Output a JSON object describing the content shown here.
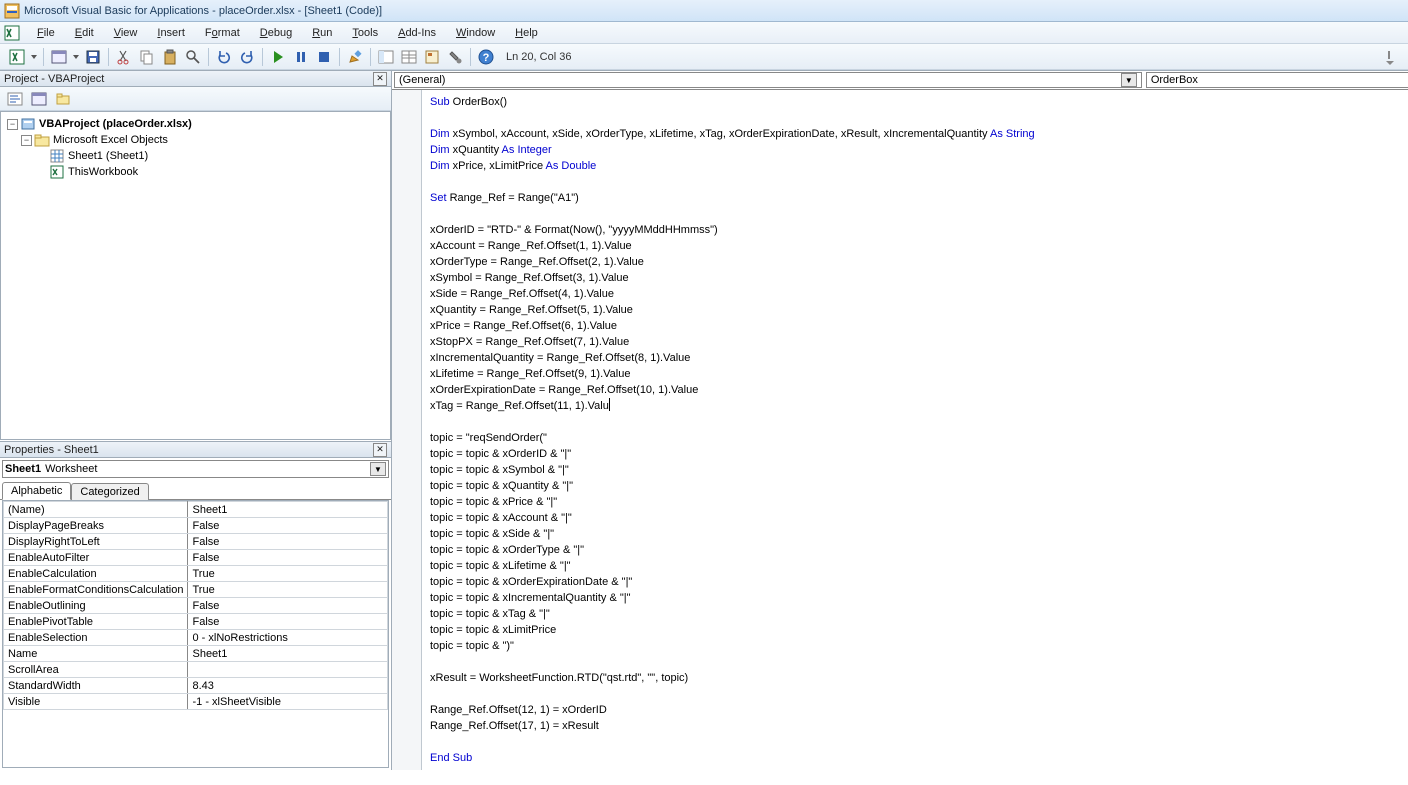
{
  "titlebar": "Microsoft Visual Basic for Applications - placeOrder.xlsx - [Sheet1 (Code)]",
  "menus": [
    "File",
    "Edit",
    "View",
    "Insert",
    "Format",
    "Debug",
    "Run",
    "Tools",
    "Add-Ins",
    "Window",
    "Help"
  ],
  "menu_hotkeys": [
    "F",
    "E",
    "V",
    "I",
    "o",
    "D",
    "R",
    "T",
    "A",
    "W",
    "H"
  ],
  "status": "Ln 20, Col 36",
  "project_pane_title": "Project - VBAProject",
  "properties_pane_title": "Properties - Sheet1",
  "tree": {
    "root": "VBAProject (placeOrder.xlsx)",
    "folder": "Microsoft Excel Objects",
    "items": [
      "Sheet1 (Sheet1)",
      "ThisWorkbook"
    ]
  },
  "prop_combo": {
    "name": "Sheet1",
    "type": "Worksheet"
  },
  "prop_tabs": [
    "Alphabetic",
    "Categorized"
  ],
  "properties": [
    {
      "name": "(Name)",
      "value": "Sheet1"
    },
    {
      "name": "DisplayPageBreaks",
      "value": "False"
    },
    {
      "name": "DisplayRightToLeft",
      "value": "False"
    },
    {
      "name": "EnableAutoFilter",
      "value": "False"
    },
    {
      "name": "EnableCalculation",
      "value": "True"
    },
    {
      "name": "EnableFormatConditionsCalculation",
      "value": "True"
    },
    {
      "name": "EnableOutlining",
      "value": "False"
    },
    {
      "name": "EnablePivotTable",
      "value": "False"
    },
    {
      "name": "EnableSelection",
      "value": "0 - xlNoRestrictions"
    },
    {
      "name": "Name",
      "value": "Sheet1"
    },
    {
      "name": "ScrollArea",
      "value": ""
    },
    {
      "name": "StandardWidth",
      "value": "8.43"
    },
    {
      "name": "Visible",
      "value": "-1 - xlSheetVisible"
    }
  ],
  "code_left_dd": "(General)",
  "code_right_dd": "OrderBox",
  "code": {
    "p1": "Sub",
    "p1b": " OrderBox()",
    "p2": "Dim",
    "p2b": " xSymbol, xAccount, xSide, xOrderType, xLifetime, xTag, xOrderExpirationDate, xResult, xIncrementalQuantity ",
    "p2c": "As String",
    "p3": "Dim",
    "p3b": " xQuantity ",
    "p3c": "As Integer",
    "p4": "Dim",
    "p4b": " xPrice, xLimitPrice ",
    "p4c": "As Double",
    "p5": "Set",
    "p5b": " Range_Ref = Range(\"A1\")",
    "l1": "xOrderID = \"RTD-\" & Format(Now(), \"yyyyMMddHHmmss\")",
    "l2": "xAccount = Range_Ref.Offset(1, 1).Value",
    "l3": "xOrderType = Range_Ref.Offset(2, 1).Value",
    "l4": "xSymbol = Range_Ref.Offset(3, 1).Value",
    "l5": "xSide = Range_Ref.Offset(4, 1).Value",
    "l6": "xQuantity = Range_Ref.Offset(5, 1).Value",
    "l7": "xPrice = Range_Ref.Offset(6, 1).Value",
    "l8": "xStopPX = Range_Ref.Offset(7, 1).Value",
    "l9": "xIncrementalQuantity = Range_Ref.Offset(8, 1).Value",
    "l10": "xLifetime = Range_Ref.Offset(9, 1).Value",
    "l11": "xOrderExpirationDate = Range_Ref.Offset(10, 1).Value",
    "l12": "xTag = Range_Ref.Offset(11, 1).Valu",
    "t1": "topic = \"reqSendOrder(\"",
    "t2": "topic = topic & xOrderID & \"|\"",
    "t3": "topic = topic & xSymbol & \"|\"",
    "t4": "topic = topic & xQuantity & \"|\"",
    "t5": "topic = topic & xPrice & \"|\"",
    "t6": "topic = topic & xAccount & \"|\"",
    "t7": "topic = topic & xSide & \"|\"",
    "t8": "topic = topic & xOrderType & \"|\"",
    "t9": "topic = topic & xLifetime & \"|\"",
    "t10": "topic = topic & xOrderExpirationDate & \"|\"",
    "t11": "topic = topic & xIncrementalQuantity & \"|\"",
    "t12": "topic = topic & xTag & \"|\"",
    "t13": "topic = topic & xLimitPrice",
    "t14": "topic = topic & \")\"",
    "r1": "xResult = WorksheetFunction.RTD(\"qst.rtd\", \"\", topic)",
    "r2": "Range_Ref.Offset(12, 1) = xOrderID",
    "r3": "Range_Ref.Offset(17, 1) = xResult",
    "end": "End Sub"
  }
}
